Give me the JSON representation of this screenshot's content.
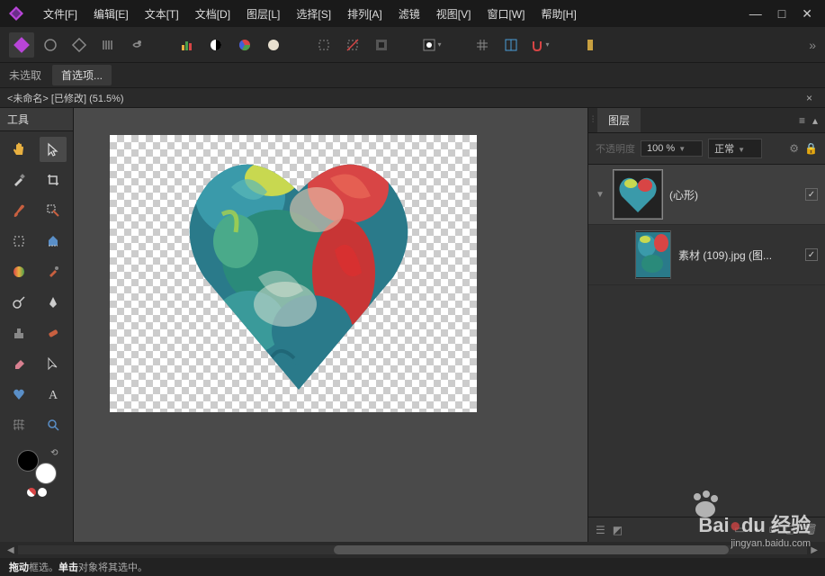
{
  "menu": {
    "file": "文件[F]",
    "edit": "编辑[E]",
    "text": "文本[T]",
    "document": "文档[D]",
    "layer": "图层[L]",
    "select": "选择[S]",
    "arrange": "排列[A]",
    "filters": "滤镜",
    "view": "视图[V]",
    "window": "窗口[W]",
    "help": "帮助[H]"
  },
  "optionsbar": {
    "unselected": "未选取",
    "preferences": "首选项..."
  },
  "document_tab": "<未命名> [已修改] (51.5%)",
  "tools_panel_title": "工具",
  "layers": {
    "panel_title": "图层",
    "opacity_label": "不透明度",
    "opacity_value": "100 %",
    "blend_mode": "正常",
    "items": [
      {
        "name": "(心形)",
        "visible": true,
        "selected": true,
        "expandable": true
      },
      {
        "name": "素材 (109).jpg (图...",
        "visible": true,
        "selected": false,
        "expandable": false
      }
    ]
  },
  "statusbar": {
    "drag": "拖动",
    "drag_desc": " 框选。",
    "click": "单击",
    "click_desc": " 对象将其选中。"
  },
  "watermark": {
    "brand": "Bai",
    "brand2": "du",
    "suffix": "经验",
    "url": "jingyan.baidu.com"
  },
  "colors": {
    "bg": "#222222",
    "panel": "#323232",
    "accent_app": "#b845d8"
  }
}
